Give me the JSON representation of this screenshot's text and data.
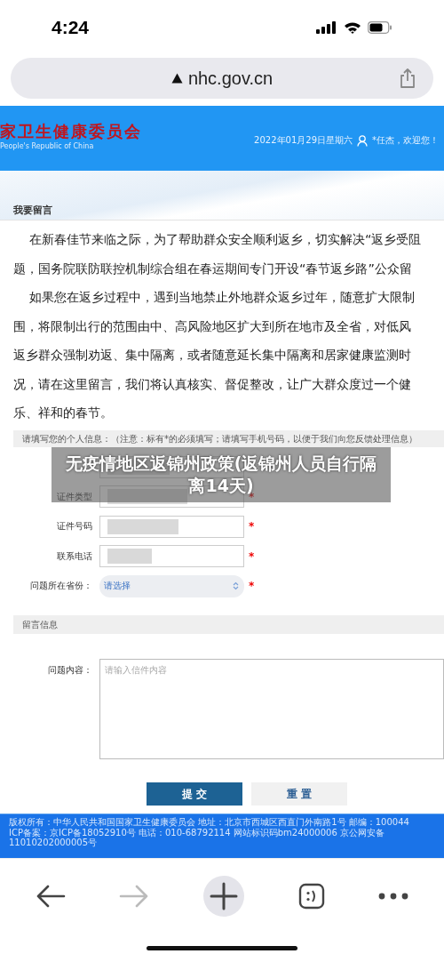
{
  "status_bar": {
    "time": "4:24"
  },
  "address_bar": {
    "url": "nhc.gov.cn"
  },
  "site_header": {
    "title": "家卫生健康委员会",
    "subtitle": "People's Republic of China",
    "date": "2022年01月29日星期六",
    "user": "*任杰，欢迎您！"
  },
  "section_title": "我要留言",
  "intro_lines": [
    {
      "text": "在新春佳节来临之际，为了帮助群众安全顺利返乡，切实解决“返乡受阻",
      "indent": true
    },
    {
      "text": "题，国务院联防联控机制综合组在春运期间专门开设“春节返乡路”公众留",
      "indent": false
    },
    {
      "text": "如果您在返乡过程中，遇到当地禁止外地群众返乡过年，随意扩大限制",
      "indent": true
    },
    {
      "text": "围，将限制出行的范围由中、高风险地区扩大到所在地市及全省，对低风",
      "indent": false
    },
    {
      "text": "返乡群众强制劝返、集中隔离，或者随意延长集中隔离和居家健康监测时",
      "indent": false
    },
    {
      "text": "况，请在这里留言，我们将认真核实、督促整改，让广大群众度过一个健",
      "indent": false
    },
    {
      "text": "乐、祥和的春节。",
      "indent": false
    }
  ],
  "personal_info": {
    "heading": "请填写您的个人信息：（注意：标有*的必须填写；请填写手机号码，以便于我们向您反馈处理信息）",
    "fields": [
      {
        "kind": "input",
        "redacted": true
      },
      {
        "label": "证件类型",
        "kind": "input",
        "required_mark": "*",
        "redacted": true
      },
      {
        "label": "证件号码",
        "kind": "input",
        "required_mark": "*",
        "redacted": true
      },
      {
        "label": "联系电话",
        "kind": "input",
        "required_mark": "*",
        "redacted": true
      },
      {
        "label": "问题所在省份：",
        "kind": "select",
        "value": "请选择",
        "required_mark": "*"
      }
    ]
  },
  "caption_overlay": "无疫情地区返锦州政策(返锦州人员自行隔离14天)",
  "message_info": {
    "heading": "留言信息",
    "label": "问题内容：",
    "placeholder": "请输入信件内容"
  },
  "buttons": [
    {
      "label": "提 交",
      "kind": "primary"
    },
    {
      "label": "重 置",
      "kind": "secondary"
    }
  ],
  "footer_lines": [
    "版权所有：中华人民共和国国家卫生健康委员会 地址：北京市西城区西直门外南路1号 邮编：100044",
    "ICP备案：京ICP备18052910号 电话：010-68792114 网站标识码bm24000006 京公网安备 11010202000005号"
  ],
  "browser_toolbar": {
    "back_enabled": true,
    "forward_enabled": false
  }
}
